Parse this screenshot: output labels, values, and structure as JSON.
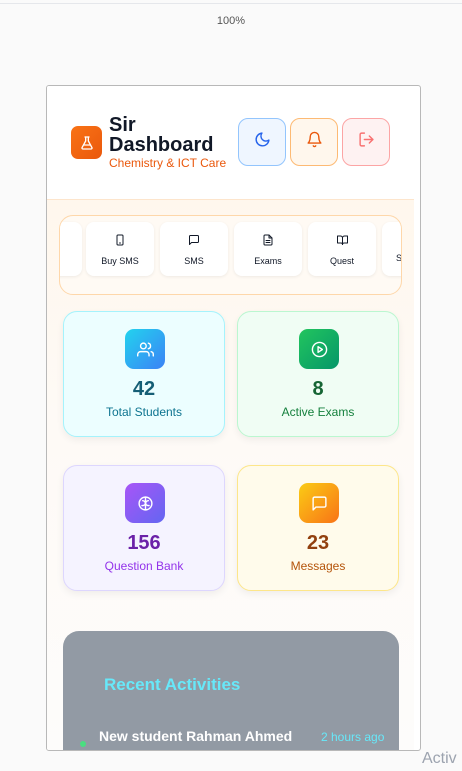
{
  "browser": {
    "zoom": "100%"
  },
  "header": {
    "title_line1": "Sir",
    "title_line2": "Dashboard",
    "subtitle": "Chemistry & ICT Care",
    "logo_icon": "flask-icon",
    "buttons": [
      {
        "name": "theme-toggle-button",
        "icon": "moon-icon"
      },
      {
        "name": "notifications-button",
        "icon": "bell-icon"
      },
      {
        "name": "logout-button",
        "icon": "logout-icon"
      }
    ]
  },
  "nav": {
    "items": [
      {
        "label": "",
        "icon": ""
      },
      {
        "label": "Buy SMS",
        "icon": "phone-icon"
      },
      {
        "label": "SMS",
        "icon": "message-icon"
      },
      {
        "label": "Exams",
        "icon": "document-icon"
      },
      {
        "label": "Quest",
        "icon": "book-open-icon"
      },
      {
        "label": "S",
        "icon": ""
      }
    ]
  },
  "stats": [
    {
      "value": "42",
      "label": "Total Students",
      "icon": "users-icon",
      "color": "#155e75"
    },
    {
      "value": "8",
      "label": "Active Exams",
      "icon": "play-circle-icon",
      "color": "#166534"
    },
    {
      "value": "156",
      "label": "Question Bank",
      "icon": "brain-icon",
      "color": "#6b21a8"
    },
    {
      "value": "23",
      "label": "Messages",
      "icon": "message-square-icon",
      "color": "#92400e"
    }
  ],
  "activities": {
    "title": "Recent Activities",
    "items": [
      {
        "text": "New student Rahman Ahmed joined",
        "time": "2 hours ago"
      }
    ]
  },
  "watermark": "Activ"
}
